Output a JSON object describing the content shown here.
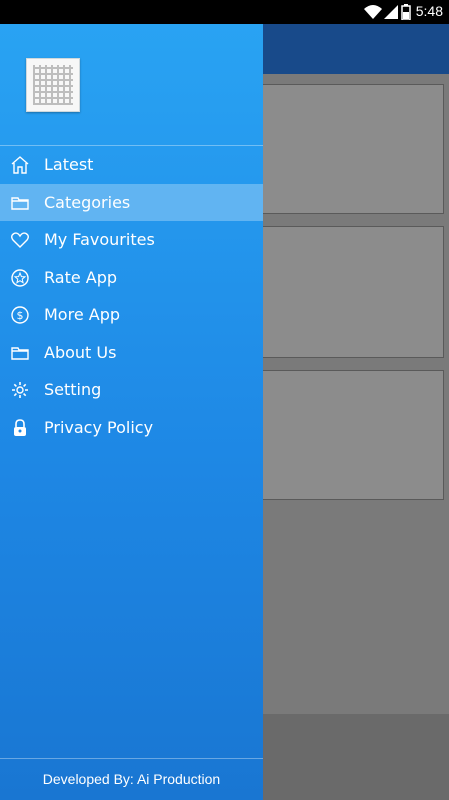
{
  "status_bar": {
    "time": "5:48",
    "icons": [
      "wifi-icon",
      "signal-icon",
      "battery-icon"
    ]
  },
  "drawer": {
    "logo": "app-logo-chord-grid",
    "menu": [
      {
        "label": "Latest",
        "icon": "home-icon",
        "active": false
      },
      {
        "label": "Categories",
        "icon": "folder-icon",
        "active": true
      },
      {
        "label": "My Favourites",
        "icon": "heart-icon",
        "active": false
      },
      {
        "label": "Rate App",
        "icon": "star-icon",
        "active": false
      },
      {
        "label": "More App",
        "icon": "dollar-icon",
        "active": false
      },
      {
        "label": "About Us",
        "icon": "folder-icon",
        "active": false
      },
      {
        "label": "Setting",
        "icon": "gear-icon",
        "active": false
      },
      {
        "label": "Privacy Policy",
        "icon": "lock-icon",
        "active": false
      }
    ],
    "footer": "Developed By: Ai Production"
  },
  "colors": {
    "drawer_top": "#29a3f3",
    "drawer_bottom": "#1976d2",
    "app_bar": "#184a8a"
  }
}
